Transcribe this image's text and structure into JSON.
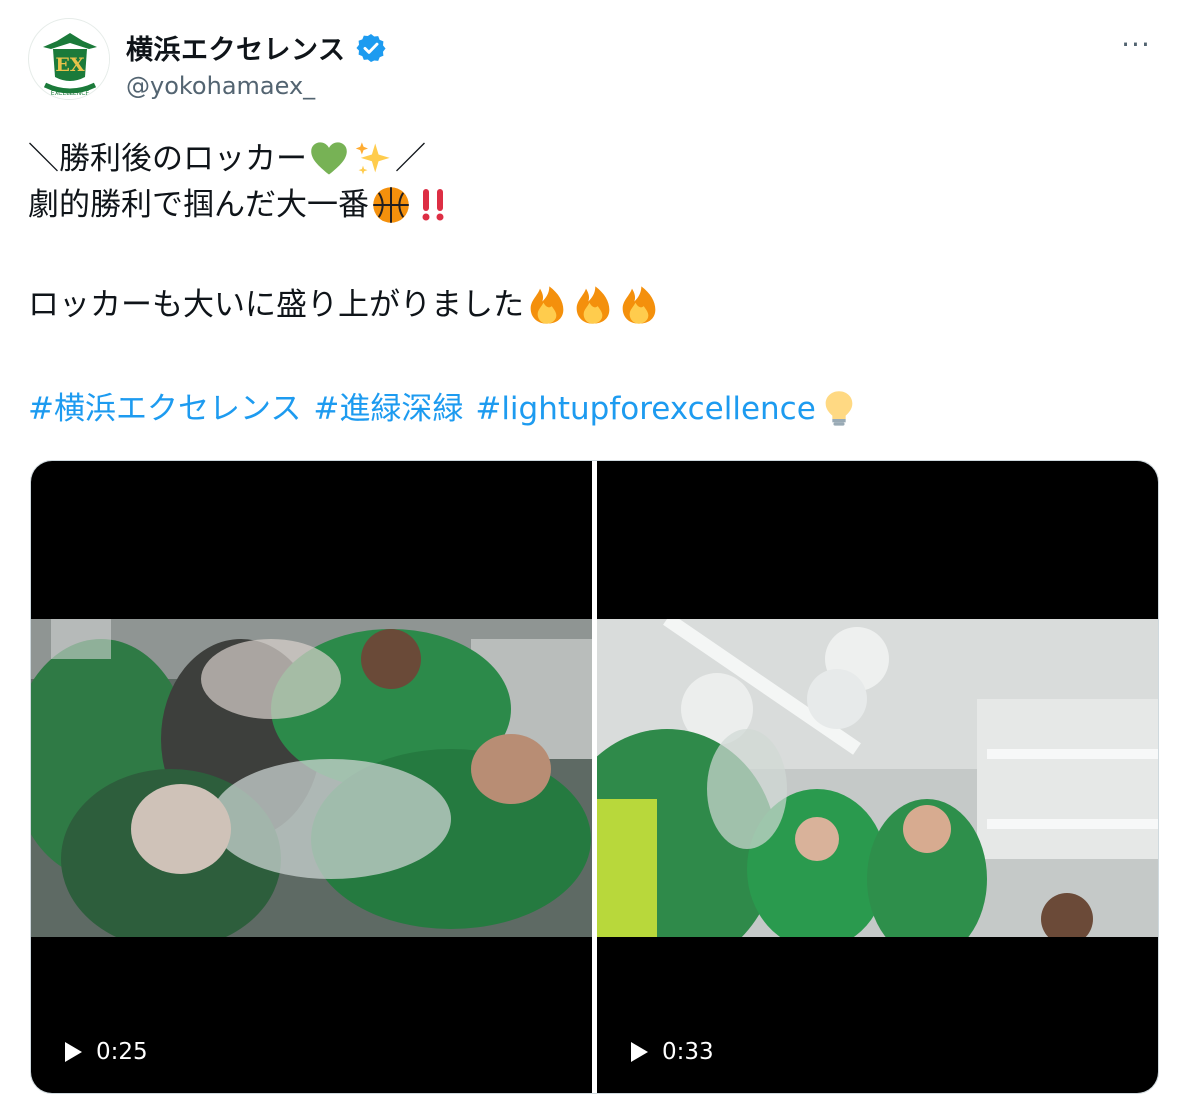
{
  "account": {
    "display_name": "横浜エクセレンス",
    "handle": "@yokohamaex_",
    "verified": true,
    "avatar_text": "EX",
    "avatar_caption": "EXCELLENCE"
  },
  "tweet": {
    "line1_pre": "＼勝利後のロッカー",
    "line1_post": "／",
    "line2_pre": "劇的勝利で掴んだ大一番",
    "line3_pre": "ロッカーも大いに盛り上がりました",
    "hashtags": [
      "#横浜エクセレンス",
      "#進緑深緑",
      "#lightupforexcellence"
    ]
  },
  "media": {
    "videos": [
      {
        "duration": "0:25"
      },
      {
        "duration": "0:33"
      }
    ]
  },
  "icons": {
    "more": "more-icon",
    "verified": "verified-badge-icon",
    "emoji": [
      "green-heart-icon",
      "sparkles-icon",
      "basketball-icon",
      "double-exclamation-icon",
      "fire-icon",
      "light-bulb-icon"
    ]
  },
  "colors": {
    "hashtag": "#1d9bf0",
    "verified": "#1d9bf0",
    "handle": "#536471",
    "brand_green": "#1b7a3a"
  }
}
